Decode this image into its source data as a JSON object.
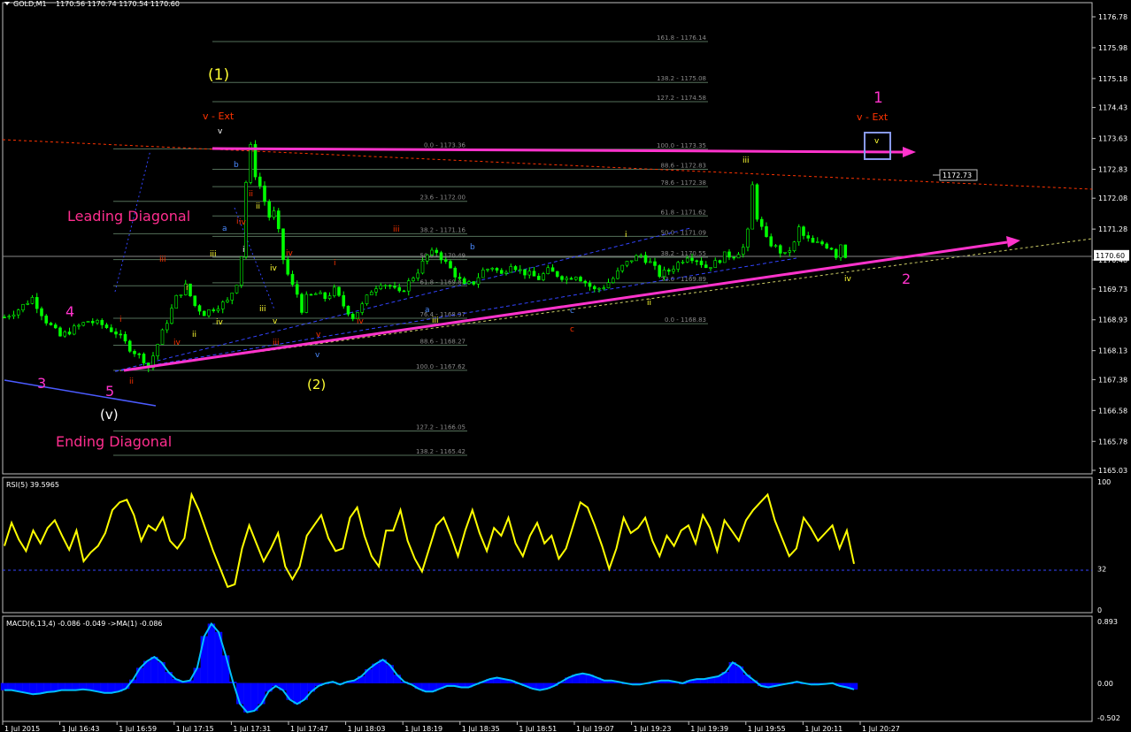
{
  "header": {
    "symbol_label": "GOLD,M1",
    "ohlc": "1170.56 1170.74 1170.54 1170.60"
  },
  "colors": {
    "background": "#000000",
    "grid_frame": "#c0c0c0",
    "candle": "#00ff00",
    "rsi_line": "#ffff00",
    "macd_hist": "#0000ff",
    "macd_signal": "#00bfff",
    "magenta": "#ff33cc",
    "fib": "#8a8a8a",
    "red_wave": "#ff3300",
    "blue_wave": "#4b8bff",
    "yellow_label": "#ffff33",
    "label_pink": "#ff2e8e"
  },
  "chart_data": [
    {
      "type": "candlestick",
      "title": "GOLD,M1",
      "price_axis": {
        "ticks": [
          "1176.78",
          "1175.98",
          "1175.18",
          "1174.43",
          "1173.63",
          "1172.83",
          "1172.08",
          "1171.28",
          "1170.48",
          "1169.73",
          "1168.93",
          "1168.13",
          "1167.38",
          "1166.58",
          "1165.78",
          "1165.03"
        ],
        "range": [
          1165.03,
          1176.78
        ],
        "current_price": "1170.60",
        "marker_price": "1172.73"
      },
      "time_axis": {
        "ticks": [
          "1 Jul 2015",
          "1 Jul 16:43",
          "1 Jul 16:59",
          "1 Jul 17:15",
          "1 Jul 17:31",
          "1 Jul 17:47",
          "1 Jul 18:03",
          "1 Jul 18:19",
          "1 Jul 18:35",
          "1 Jul 18:51",
          "1 Jul 19:07",
          "1 Jul 19:23",
          "1 Jul 19:39",
          "1 Jul 19:55",
          "1 Jul 20:11",
          "1 Jul 20:27"
        ]
      },
      "price_path": [
        [
          0,
          1169.0
        ],
        [
          3,
          1169.2
        ],
        [
          6,
          1169.5
        ],
        [
          9,
          1168.9
        ],
        [
          12,
          1168.5
        ],
        [
          15,
          1168.7
        ],
        [
          18,
          1168.9
        ],
        [
          21,
          1168.8
        ],
        [
          24,
          1168.6
        ],
        [
          27,
          1168.2
        ],
        [
          30,
          1167.9
        ],
        [
          31,
          1167.7
        ],
        [
          33,
          1168.3
        ],
        [
          35,
          1168.9
        ],
        [
          37,
          1169.5
        ],
        [
          39,
          1169.8
        ],
        [
          41,
          1169.3
        ],
        [
          43,
          1169.1
        ],
        [
          46,
          1169.3
        ],
        [
          48,
          1169.4
        ],
        [
          50,
          1169.9
        ],
        [
          51,
          1170.6
        ],
        [
          52,
          1172.5
        ],
        [
          53,
          1173.4
        ],
        [
          54,
          1172.7
        ],
        [
          55,
          1172.4
        ],
        [
          56,
          1172.0
        ],
        [
          57,
          1171.6
        ],
        [
          58,
          1171.7
        ],
        [
          59,
          1171.2
        ],
        [
          60,
          1170.5
        ],
        [
          61,
          1170.1
        ],
        [
          62,
          1169.8
        ],
        [
          63,
          1169.6
        ],
        [
          64,
          1169.2
        ],
        [
          65,
          1169.5
        ],
        [
          67,
          1169.6
        ],
        [
          69,
          1169.5
        ],
        [
          71,
          1169.7
        ],
        [
          73,
          1169.3
        ],
        [
          75,
          1169.0
        ],
        [
          77,
          1169.3
        ],
        [
          79,
          1169.7
        ],
        [
          81,
          1169.9
        ],
        [
          83,
          1169.8
        ],
        [
          85,
          1169.6
        ],
        [
          87,
          1169.9
        ],
        [
          89,
          1170.2
        ],
        [
          91,
          1170.6
        ],
        [
          93,
          1170.7
        ],
        [
          95,
          1170.4
        ],
        [
          97,
          1170.1
        ],
        [
          99,
          1169.8
        ],
        [
          101,
          1169.9
        ],
        [
          103,
          1170.2
        ],
        [
          105,
          1170.3
        ],
        [
          107,
          1170.1
        ],
        [
          109,
          1170.4
        ],
        [
          111,
          1170.2
        ],
        [
          113,
          1170.1
        ],
        [
          115,
          1170.0
        ],
        [
          117,
          1170.2
        ],
        [
          119,
          1170.1
        ],
        [
          121,
          1170.0
        ],
        [
          123,
          1170.1
        ],
        [
          125,
          1169.9
        ],
        [
          127,
          1169.7
        ],
        [
          129,
          1169.8
        ],
        [
          131,
          1170.0
        ],
        [
          133,
          1170.3
        ],
        [
          135,
          1170.5
        ],
        [
          137,
          1170.6
        ],
        [
          139,
          1170.4
        ],
        [
          141,
          1170.1
        ],
        [
          143,
          1170.2
        ],
        [
          145,
          1170.4
        ],
        [
          147,
          1170.6
        ],
        [
          149,
          1170.5
        ],
        [
          151,
          1170.3
        ],
        [
          153,
          1170.4
        ],
        [
          155,
          1170.6
        ],
        [
          157,
          1170.6
        ],
        [
          159,
          1170.8
        ],
        [
          160,
          1171.2
        ],
        [
          161,
          1172.4
        ],
        [
          162,
          1171.6
        ],
        [
          163,
          1171.3
        ],
        [
          164,
          1171.0
        ],
        [
          166,
          1170.8
        ],
        [
          168,
          1170.6
        ],
        [
          170,
          1170.9
        ],
        [
          171,
          1171.3
        ],
        [
          172,
          1171.1
        ],
        [
          174,
          1170.9
        ],
        [
          176,
          1170.9
        ],
        [
          178,
          1170.8
        ],
        [
          179,
          1170.6
        ],
        [
          180,
          1170.9
        ],
        [
          181,
          1170.6
        ]
      ]
    },
    {
      "type": "line",
      "title": "RSI(5) 39.5965",
      "levels": [
        "100",
        "32",
        "0"
      ],
      "ylim": [
        0,
        100
      ],
      "values": [
        50,
        68,
        55,
        46,
        62,
        52,
        64,
        70,
        58,
        47,
        62,
        38,
        45,
        50,
        60,
        78,
        84,
        86,
        74,
        54,
        66,
        62,
        72,
        54,
        48,
        56,
        90,
        78,
        62,
        46,
        32,
        18,
        20,
        48,
        66,
        52,
        38,
        48,
        60,
        34,
        24,
        34,
        58,
        66,
        74,
        56,
        46,
        48,
        72,
        80,
        58,
        42,
        34,
        62,
        62,
        78,
        54,
        40,
        30,
        48,
        66,
        72,
        58,
        42,
        62,
        78,
        60,
        46,
        64,
        58,
        72,
        52,
        42,
        58,
        68,
        52,
        58,
        40,
        48,
        66,
        84,
        80,
        66,
        50,
        32,
        48,
        72,
        60,
        64,
        72,
        54,
        42,
        58,
        50,
        62,
        66,
        52,
        74,
        64,
        46,
        70,
        62,
        54,
        70,
        78,
        84,
        90,
        70,
        56,
        42,
        48,
        72,
        64,
        54,
        60,
        66,
        48,
        62,
        36
      ]
    },
    {
      "type": "area",
      "title": "MACD(6,13,4) -0.086 -0.049 ->MA(1) -0.086",
      "levels": [
        "0.893",
        "0.00",
        "-0.502"
      ],
      "ylim": [
        -0.502,
        0.893
      ],
      "values": [
        -0.1,
        -0.1,
        -0.12,
        -0.14,
        -0.16,
        -0.15,
        -0.13,
        -0.12,
        -0.1,
        -0.1,
        -0.1,
        -0.09,
        -0.1,
        -0.12,
        -0.14,
        -0.14,
        -0.12,
        -0.08,
        0.05,
        0.22,
        0.32,
        0.38,
        0.3,
        0.16,
        0.06,
        0.02,
        0.04,
        0.22,
        0.68,
        0.86,
        0.74,
        0.4,
        0.02,
        -0.3,
        -0.42,
        -0.4,
        -0.3,
        -0.12,
        -0.04,
        -0.1,
        -0.24,
        -0.3,
        -0.24,
        -0.12,
        -0.04,
        0.0,
        0.02,
        -0.02,
        0.02,
        0.04,
        0.1,
        0.2,
        0.28,
        0.34,
        0.26,
        0.12,
        0.02,
        -0.02,
        -0.08,
        -0.12,
        -0.12,
        -0.08,
        -0.04,
        -0.04,
        -0.06,
        -0.06,
        -0.02,
        0.02,
        0.06,
        0.08,
        0.06,
        0.04,
        0.0,
        -0.04,
        -0.08,
        -0.1,
        -0.08,
        -0.04,
        0.02,
        0.08,
        0.12,
        0.14,
        0.12,
        0.08,
        0.04,
        0.04,
        0.02,
        0.0,
        -0.02,
        -0.02,
        0.0,
        0.02,
        0.04,
        0.04,
        0.02,
        0.0,
        0.04,
        0.06,
        0.06,
        0.08,
        0.1,
        0.16,
        0.3,
        0.24,
        0.12,
        0.04,
        -0.04,
        -0.06,
        -0.04,
        -0.02,
        0.0,
        0.02,
        0.0,
        -0.02,
        -0.02,
        -0.01,
        0.0,
        -0.04,
        -0.06,
        -0.09
      ]
    }
  ],
  "fib_levels": [
    {
      "label": "161.8 - 1176.14",
      "price": 1176.14,
      "group": "upper"
    },
    {
      "label": "138.2 - 1175.08",
      "price": 1175.08,
      "group": "upper"
    },
    {
      "label": "127.2 - 1174.58",
      "price": 1174.58,
      "group": "upper"
    },
    {
      "label": "100.0 - 1173.35",
      "price": 1173.35,
      "group": "upper"
    },
    {
      "label": "88.6 - 1172.83",
      "price": 1172.83,
      "group": "upper"
    },
    {
      "label": "78.6 - 1172.38",
      "price": 1172.38,
      "group": "upper"
    },
    {
      "label": "61.8 - 1171.62",
      "price": 1171.62,
      "group": "upper"
    },
    {
      "label": "50.0 - 1171.09",
      "price": 1171.09,
      "group": "upper"
    },
    {
      "label": "38.2 - 1170.55",
      "price": 1170.55,
      "group": "upper"
    },
    {
      "label": "23.6 - 1169.89",
      "price": 1169.89,
      "group": "upper"
    },
    {
      "label": "0.0 - 1168.83",
      "price": 1168.83,
      "group": "upper"
    },
    {
      "label": "0.0 - 1173.36",
      "price": 1173.36,
      "group": "left"
    },
    {
      "label": "23.6 - 1172.00",
      "price": 1172.0,
      "group": "left"
    },
    {
      "label": "38.2 - 1171.16",
      "price": 1171.16,
      "group": "left"
    },
    {
      "label": "50.0 - 1170.49",
      "price": 1170.49,
      "group": "left"
    },
    {
      "label": "61.8 - 1169.81",
      "price": 1169.81,
      "group": "left"
    },
    {
      "label": "76.4 - 1168.97",
      "price": 1168.97,
      "group": "left"
    },
    {
      "label": "88.6 - 1168.27",
      "price": 1168.27,
      "group": "left"
    },
    {
      "label": "100.0 - 1167.62",
      "price": 1167.62,
      "group": "left"
    },
    {
      "label": "127.2 - 1166.05",
      "price": 1166.05,
      "group": "left"
    },
    {
      "label": "138.2 - 1165.42",
      "price": 1165.42,
      "group": "left"
    }
  ],
  "annotations": {
    "wave_1_paren": "(1)",
    "wave_2_paren": "(2)",
    "wave_v_paren": "(v)",
    "v_ext_left": "v - Ext",
    "v_ext_right": "v - Ext",
    "leading_diagonal": "Leading Diagonal",
    "ending_diagonal": "Ending Diagonal",
    "n1": "1",
    "n2": "2",
    "n3": "3",
    "n4": "4",
    "n5": "5",
    "boxed_v": "v",
    "small": [
      {
        "t": "i"
      },
      {
        "t": "ii"
      },
      {
        "t": "iii"
      },
      {
        "t": "iv"
      },
      {
        "t": "v"
      },
      {
        "t": "i"
      },
      {
        "t": "ii"
      },
      {
        "t": "iii"
      },
      {
        "t": "iv"
      },
      {
        "t": "v"
      },
      {
        "t": "i"
      },
      {
        "t": "ii"
      },
      {
        "t": "iii"
      },
      {
        "t": "iv"
      },
      {
        "t": "v"
      },
      {
        "t": "b"
      },
      {
        "t": "a"
      },
      {
        "t": "i"
      },
      {
        "t": "ii"
      },
      {
        "t": "iii"
      },
      {
        "t": "iv"
      },
      {
        "t": "v"
      },
      {
        "t": "i"
      },
      {
        "t": "iii"
      },
      {
        "t": "iv"
      },
      {
        "t": "iii"
      },
      {
        "t": "a"
      },
      {
        "t": "b"
      },
      {
        "t": "c"
      },
      {
        "t": "c"
      },
      {
        "t": "iv"
      },
      {
        "t": "i"
      },
      {
        "t": "ii"
      },
      {
        "t": "iii"
      },
      {
        "t": "iv"
      },
      {
        "t": "ii"
      },
      {
        "t": "ii"
      }
    ]
  }
}
